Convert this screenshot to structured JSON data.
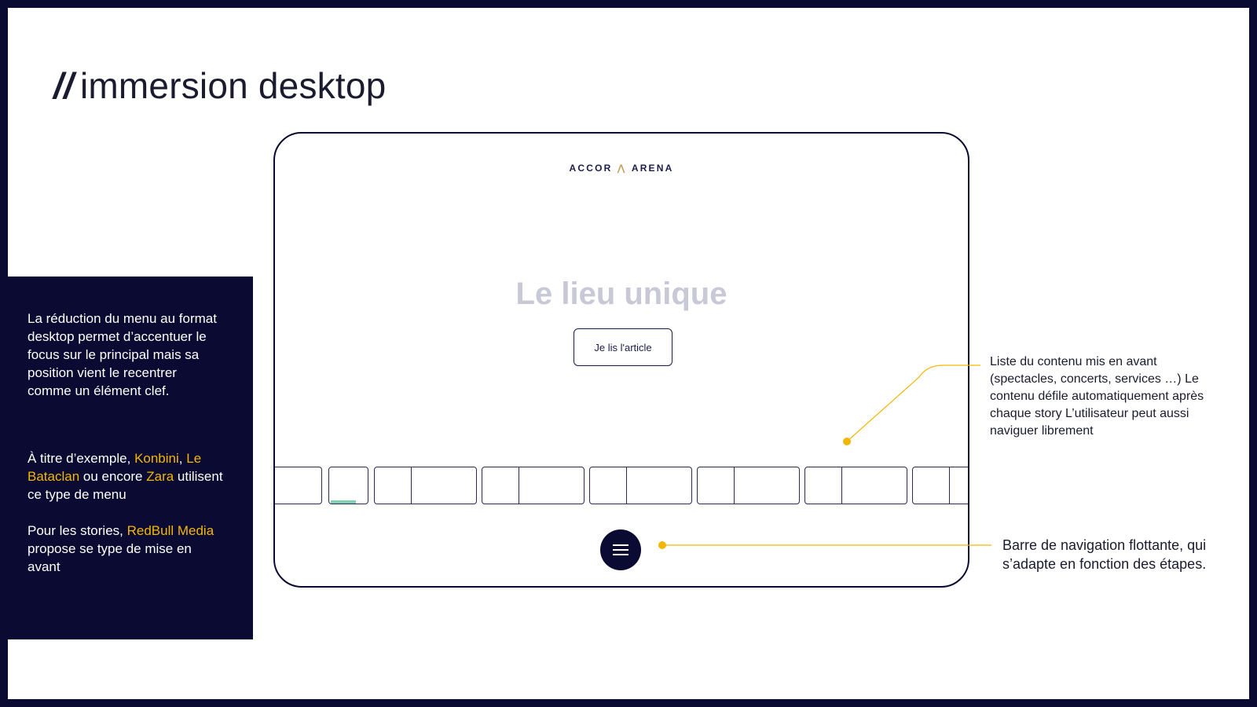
{
  "slide": {
    "title_slashes": "//",
    "title_text": "immersion desktop"
  },
  "side_panel": {
    "paragraph1": "La réduction du menu au format desktop permet d’accentuer le focus sur le principal mais sa position vient le recentrer comme un élément clef.",
    "paragraph2": {
      "prefix": "À titre d’exemple, ",
      "link1": "Konbini",
      "sep1": ", ",
      "link2": "Le Bataclan",
      "middle": " ou encore ",
      "link3": "Zara",
      "suffix": " utilisent ce type de menu"
    },
    "paragraph3": {
      "prefix": "Pour les stories, ",
      "link": "RedBull Media",
      "suffix": " propose se type de mise en avant"
    },
    "highlight_color": "#f2b705"
  },
  "mockup": {
    "logo_left": "ACCOR",
    "logo_right": "ARENA",
    "logo_mark": "accor-arena-logo-icon",
    "hero_title": "Le lieu unique",
    "cta_label": "Je lis l'article",
    "stories_count": 8,
    "active_story_progress": 0.65,
    "menu_icon": "hamburger-menu-icon"
  },
  "annotations": {
    "stories_note": "Liste du contenu mis en avant (spectacles, concerts, services …) Le contenu défile automatiquement après chaque story L’utilisateur peut aussi naviguer librement",
    "nav_note": "Barre de navigation flottante, qui s’adapte en fonction des étapes.",
    "accent_color": "#f2b705"
  },
  "colors": {
    "navy": "#0a0a32",
    "hero_text": "#c8c8d6",
    "progress": "#7dd3b0"
  }
}
